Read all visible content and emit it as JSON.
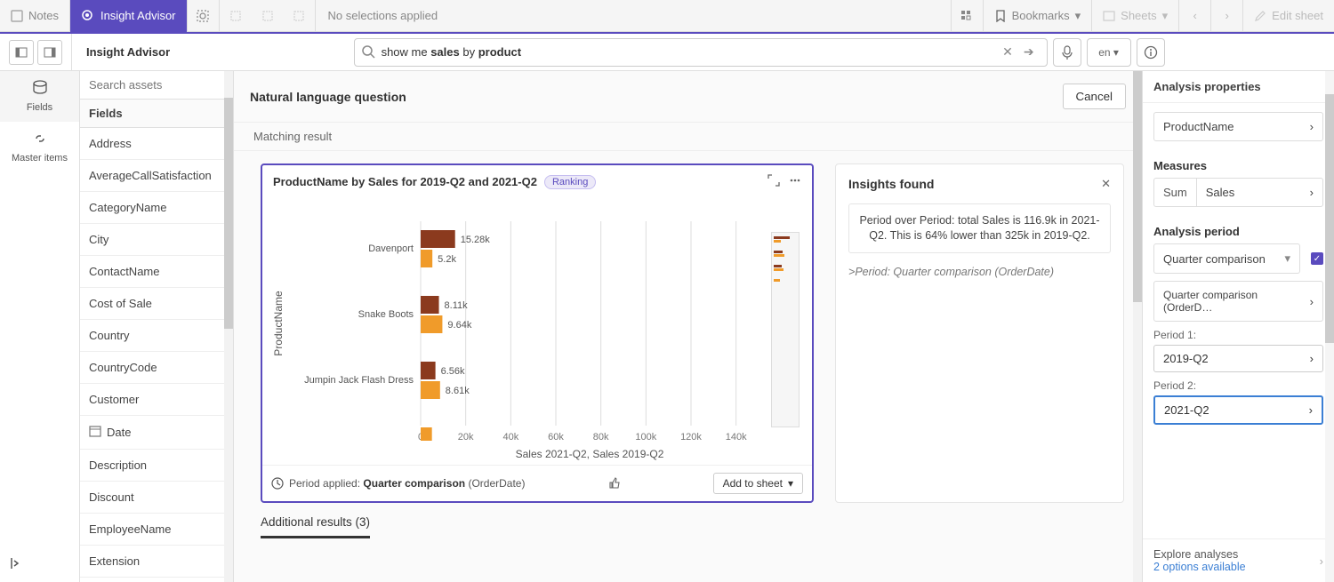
{
  "toolbar": {
    "notes_label": "Notes",
    "insight_label": "Insight Advisor",
    "no_selections_label": "No selections applied",
    "bookmarks_label": "Bookmarks",
    "sheets_label": "Sheets",
    "edit_sheet_label": "Edit sheet"
  },
  "second_bar": {
    "title": "Insight Advisor",
    "search_prefix": "show me ",
    "search_bold1": "sales",
    "search_mid": " by ",
    "search_bold2": "product",
    "full_query": "show me sales by product",
    "lang": "en"
  },
  "left_rail": {
    "fields": "Fields",
    "master": "Master items"
  },
  "fields_panel": {
    "search_placeholder": "Search assets",
    "header": "Fields",
    "items": [
      "Address",
      "AverageCallSatisfaction",
      "CategoryName",
      "City",
      "ContactName",
      "Cost of Sale",
      "Country",
      "CountryCode",
      "Customer",
      "Date",
      "Description",
      "Discount",
      "EmployeeName",
      "Extension"
    ]
  },
  "center": {
    "nl_title": "Natural language question",
    "cancel": "Cancel",
    "matching": "Matching result",
    "card_title": "ProductName by Sales for 2019-Q2 and 2021-Q2",
    "rank_badge": "Ranking",
    "period_applied_label": "Period applied:",
    "period_applied_value": "Quarter comparison",
    "period_applied_paren": "(OrderDate)",
    "add_to_sheet": "Add to sheet",
    "additional": "Additional results (3)"
  },
  "insights": {
    "title": "Insights found",
    "body": "Period over Period: total Sales is 116.9k in 2021-Q2. This is 64% lower than 325k in 2019-Q2.",
    "note_prefix": ">",
    "note": "Period: Quarter comparison (OrderDate)"
  },
  "right_panel": {
    "title": "Analysis properties",
    "dim_field": "ProductName",
    "measures_label": "Measures",
    "agg": "Sum",
    "measure_field": "Sales",
    "analysis_period_label": "Analysis period",
    "qc_label": "Quarter comparison",
    "qc_sub": "Quarter comparison (OrderD…",
    "period1_label": "Period 1:",
    "period1_value": "2019-Q2",
    "period2_label": "Period 2:",
    "period2_value": "2021-Q2",
    "explore_label": "Explore analyses",
    "explore_link": "2 options available"
  },
  "chart_data": {
    "type": "bar",
    "orientation": "horizontal",
    "title": "ProductName by Sales for 2019-Q2 and 2021-Q2",
    "ylabel": "ProductName",
    "xlabel": "Sales 2021-Q2, Sales 2019-Q2",
    "xlim": [
      0,
      150000
    ],
    "xticks": [
      0,
      20000,
      40000,
      60000,
      80000,
      100000,
      120000,
      140000
    ],
    "xtick_labels": [
      "0",
      "20k",
      "40k",
      "60k",
      "80k",
      "100k",
      "120k",
      "140k"
    ],
    "categories": [
      "Davenport",
      "Snake Boots",
      "Jumpin Jack Flash Dress"
    ],
    "series": [
      {
        "name": "Sales 2019-Q2",
        "color": "#8b3a1e",
        "values": [
          15280,
          8110,
          6560
        ],
        "labels": [
          "15.28k",
          "8.11k",
          "6.56k"
        ]
      },
      {
        "name": "Sales 2021-Q2",
        "color": "#f09b2a",
        "values": [
          5200,
          9640,
          8610
        ],
        "labels": [
          "5.2k",
          "9.64k",
          "8.61k"
        ]
      }
    ]
  }
}
